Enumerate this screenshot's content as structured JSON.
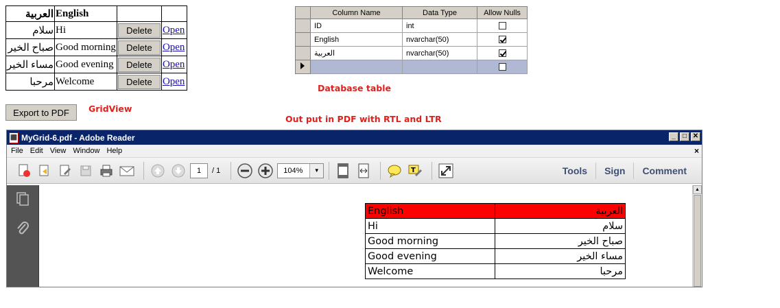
{
  "gridview": {
    "headers": [
      "العربية",
      "English",
      "",
      ""
    ],
    "rows": [
      {
        "ar": "سلام",
        "en": "Hi",
        "delete": "Delete",
        "open": "Open"
      },
      {
        "ar": "صباح الخير",
        "en": "Good morning",
        "delete": "Delete",
        "open": "Open"
      },
      {
        "ar": "مساء الخير",
        "en": "Good evening",
        "delete": "Delete",
        "open": "Open"
      },
      {
        "ar": "مرحبا",
        "en": "Welcome",
        "delete": "Delete",
        "open": "Open"
      }
    ],
    "export_label": "Export to PDF",
    "caption": "GridView"
  },
  "db_table": {
    "headers": [
      "Column Name",
      "Data Type",
      "Allow Nulls"
    ],
    "rows": [
      {
        "name": "ID",
        "type": "int",
        "allow_nulls": false
      },
      {
        "name": "English",
        "type": "nvarchar(50)",
        "allow_nulls": true
      },
      {
        "name": "العربية",
        "type": "nvarchar(50)",
        "allow_nulls": true
      },
      {
        "name": "",
        "type": "",
        "allow_nulls": false
      }
    ],
    "caption": "Database table"
  },
  "output_caption": "Out put in PDF with RTL and LTR",
  "reader": {
    "title": "MyGrid-6.pdf - Adobe Reader",
    "window_buttons": [
      "_",
      "□",
      "✕"
    ],
    "menu": [
      "File",
      "Edit",
      "View",
      "Window",
      "Help"
    ],
    "menu_close": "×",
    "page_current": "1",
    "page_total": "/ 1",
    "zoom": "104%",
    "right_links": [
      "Tools",
      "Sign",
      "Comment"
    ],
    "pdf_table": {
      "header": {
        "en": "English",
        "ar": "العربية"
      },
      "rows": [
        {
          "en": "Hi",
          "ar": "سلام"
        },
        {
          "en": "Good morning",
          "ar": "صباح الخير"
        },
        {
          "en": "Good evening",
          "ar": "مساء الخير"
        },
        {
          "en": "Welcome",
          "ar": "مرحبا"
        }
      ],
      "header_color": "#ff0000"
    }
  },
  "colors": {
    "caption_red": "#e0201c",
    "title_bar": "#0a246a",
    "selected_row": "#b0b8d4"
  }
}
